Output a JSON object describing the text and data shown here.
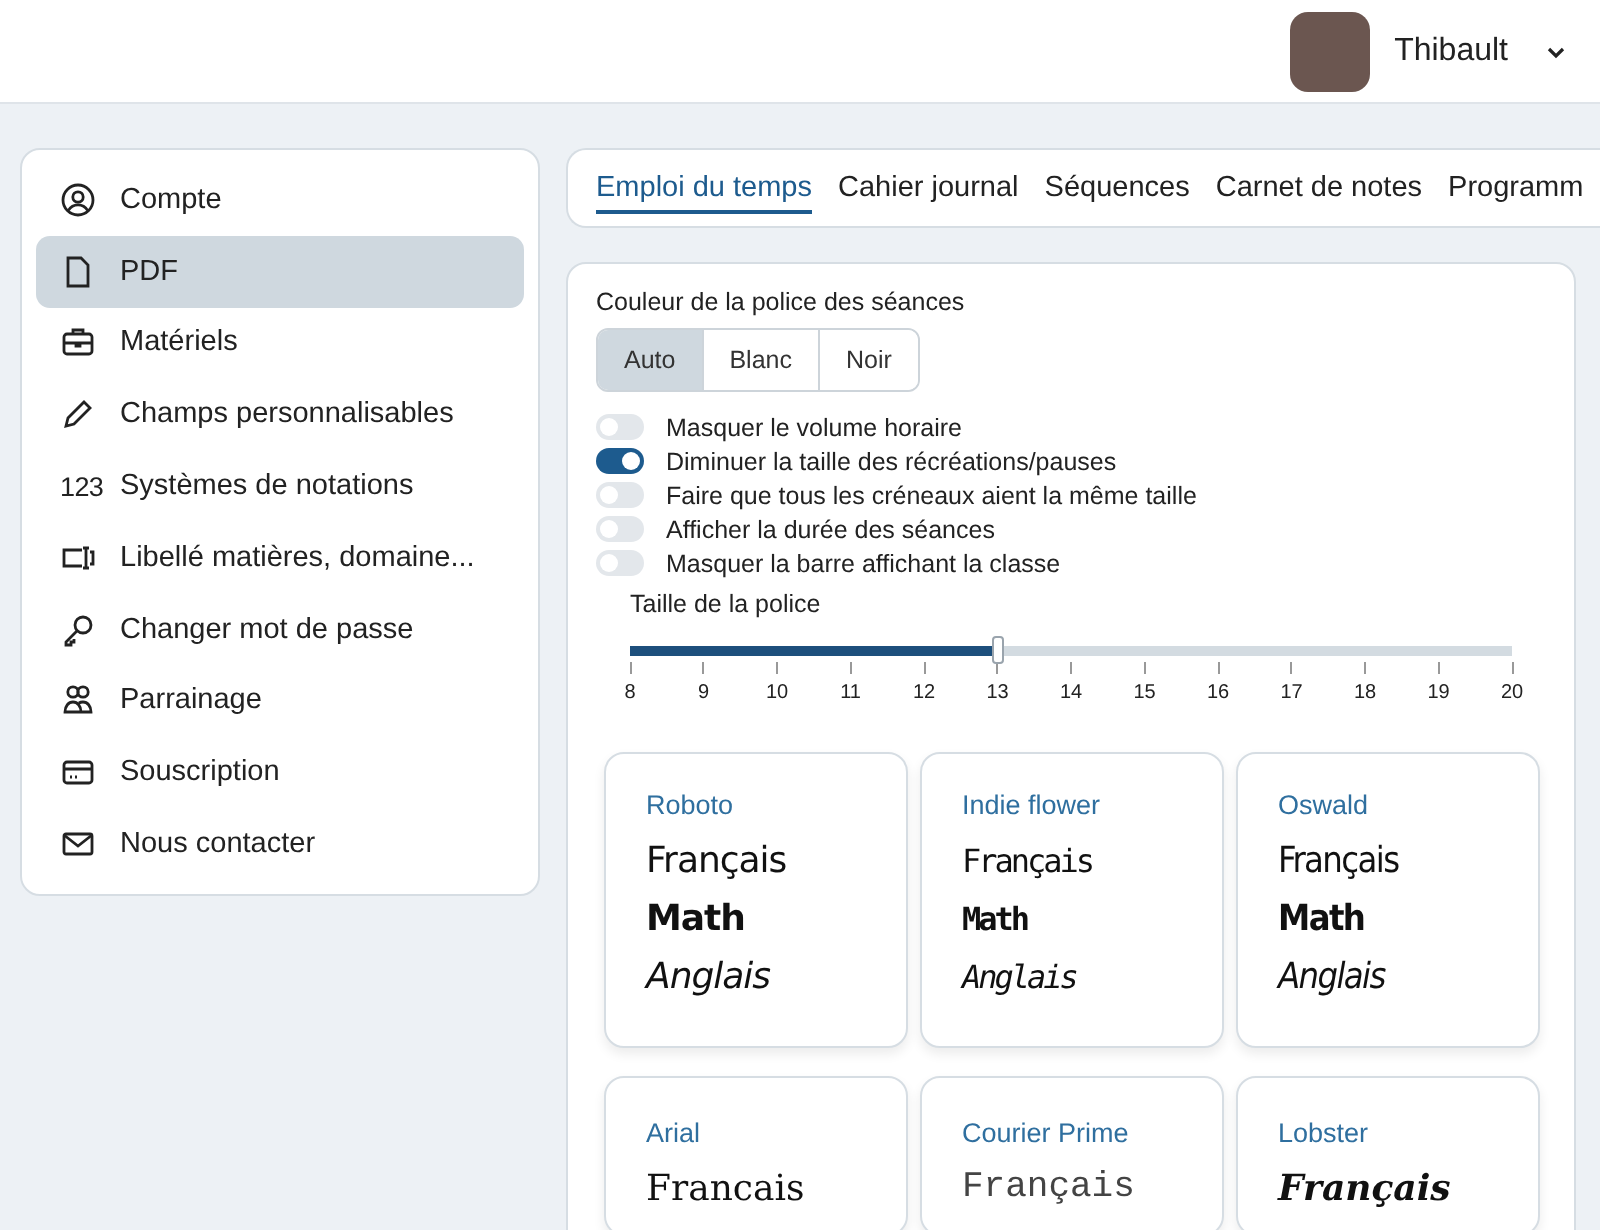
{
  "header": {
    "user_name": "Thibault"
  },
  "sidebar": {
    "items": [
      {
        "label": "Compte",
        "kind": "user",
        "selected": false
      },
      {
        "label": "PDF",
        "kind": "file",
        "selected": true
      },
      {
        "label": "Matériels",
        "kind": "briefcase",
        "selected": false
      },
      {
        "label": "Champs personnalisables",
        "kind": "pencil",
        "selected": false
      },
      {
        "label": "Systèmes de notations",
        "kind": "numbers",
        "icon_text": "123",
        "selected": false
      },
      {
        "label": "Libellé matières, domaine...",
        "kind": "textbox",
        "selected": false
      },
      {
        "label": "Changer mot de passe",
        "kind": "key",
        "selected": false
      },
      {
        "label": "Parrainage",
        "kind": "people",
        "selected": false
      },
      {
        "label": "Souscription",
        "kind": "card",
        "selected": false
      },
      {
        "label": "Nous contacter",
        "kind": "mail",
        "selected": false
      }
    ]
  },
  "tabs": [
    {
      "label": "Emploi du temps",
      "selected": true
    },
    {
      "label": "Cahier journal",
      "selected": false
    },
    {
      "label": "Séquences",
      "selected": false
    },
    {
      "label": "Carnet de notes",
      "selected": false
    },
    {
      "label": "Programm",
      "selected": false
    }
  ],
  "settings": {
    "color_label": "Couleur de la police des séances",
    "color_options": [
      {
        "label": "Auto",
        "selected": true
      },
      {
        "label": "Blanc",
        "selected": false
      },
      {
        "label": "Noir",
        "selected": false
      }
    ],
    "toggles": [
      {
        "label": "Masquer le volume horaire",
        "on": false
      },
      {
        "label": "Diminuer la taille des récréations/pauses",
        "on": true
      },
      {
        "label": "Faire que tous les créneaux aient la même taille",
        "on": false
      },
      {
        "label": "Afficher la durée des séances",
        "on": false
      },
      {
        "label": "Masquer la barre affichant la classe",
        "on": false
      }
    ],
    "font_size": {
      "label": "Taille de la police",
      "level": 0.4167,
      "ticks": [
        "8",
        "9",
        "10",
        "11",
        "12",
        "13",
        "14",
        "15",
        "16",
        "17",
        "18",
        "19",
        "20"
      ]
    },
    "font_cards": [
      {
        "name": "Roboto",
        "kind": "sans",
        "samples": [
          "Français",
          "Math",
          "Anglais"
        ]
      },
      {
        "name": "Indie flower",
        "kind": "handwriting",
        "samples": [
          "Français",
          "Math",
          "Anglais"
        ]
      },
      {
        "name": "Oswald",
        "kind": "condensed",
        "samples": [
          "Français",
          "Math",
          "Anglais"
        ]
      },
      {
        "name": "Arial",
        "kind": "serif",
        "samples": [
          "Francais"
        ]
      },
      {
        "name": "Courier Prime",
        "kind": "mono",
        "samples": [
          "Français"
        ]
      },
      {
        "name": "Lobster",
        "kind": "script",
        "samples": [
          "Français"
        ]
      }
    ]
  }
}
